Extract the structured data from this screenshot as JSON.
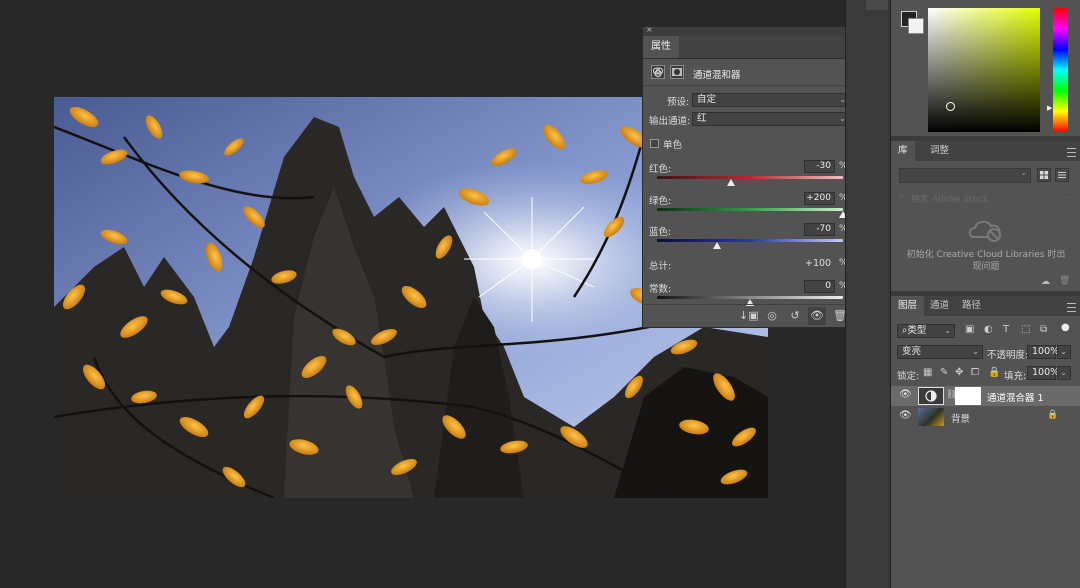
{
  "properties": {
    "tab": "属性",
    "title": "通道混和器",
    "preset_label": "预设:",
    "preset_value": "自定",
    "output_label": "输出通道:",
    "output_value": "红",
    "mono_label": "单色",
    "sliders": [
      {
        "label": "红色:",
        "value": "-30",
        "unit": "%",
        "fraction": 0.4
      },
      {
        "label": "绿色:",
        "value": "+200",
        "unit": "%",
        "fraction": 1.0
      },
      {
        "label": "蓝色:",
        "value": "-70",
        "unit": "%",
        "fraction": 0.32
      }
    ],
    "total_label": "总计:",
    "total_value": "+100",
    "total_unit": "%",
    "constant_label": "常数:",
    "constant_value": "0",
    "constant_unit": "%",
    "constant_fraction": 0.5
  },
  "library": {
    "tab_library": "库",
    "tab_adjust": "调整",
    "search_placeholder": "搜索 Adobe Stock",
    "message": "初始化 Creative Cloud Libraries 时出现问题"
  },
  "layers": {
    "tabs": [
      "图层",
      "通道",
      "路径"
    ],
    "filter_label": "类型",
    "blend_mode": "变亮",
    "opacity_label": "不透明度:",
    "opacity_value": "100%",
    "lock_label": "锁定:",
    "fill_label": "填充:",
    "fill_value": "100%",
    "items": [
      {
        "name": "通道混合器 1"
      },
      {
        "name": "背景"
      }
    ]
  },
  "colors": {
    "accent_slider_red": "#c2262e",
    "accent_slider_green": "#2ea043",
    "accent_slider_blue": "#2a33b8"
  }
}
